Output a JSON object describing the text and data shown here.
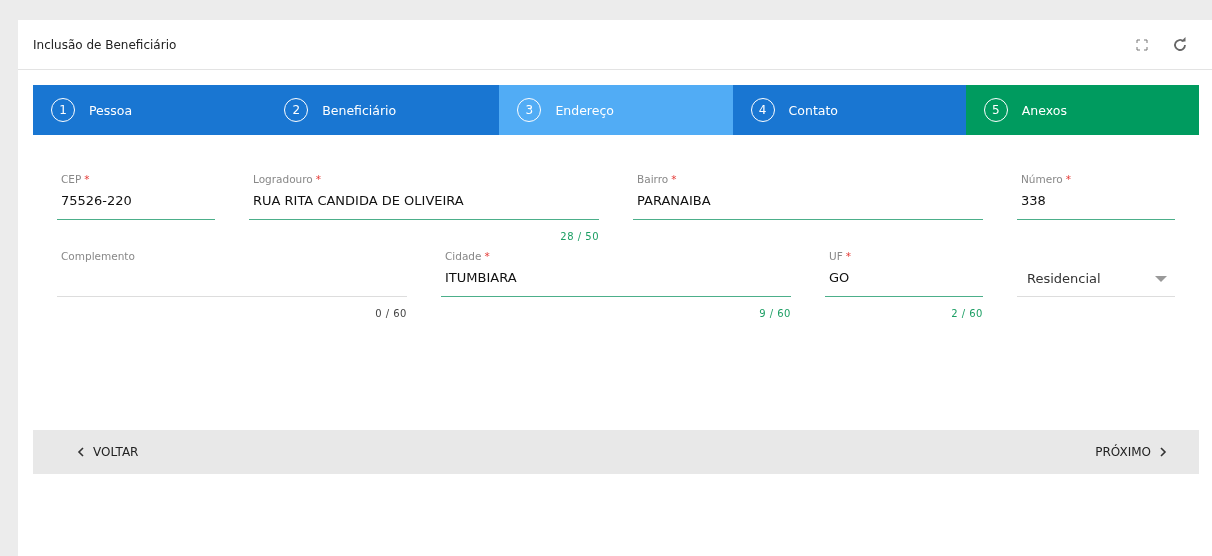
{
  "card": {
    "title": "Inclusão de Beneficiário"
  },
  "steps": [
    {
      "number": "1",
      "label": "Pessoa",
      "color": "#1976d2"
    },
    {
      "number": "2",
      "label": "Beneficiário",
      "color": "#1976d2"
    },
    {
      "number": "3",
      "label": "Endereço",
      "color": "#51acf5"
    },
    {
      "number": "4",
      "label": "Contato",
      "color": "#1976d2"
    },
    {
      "number": "5",
      "label": "Anexos",
      "color": "#009b5f"
    }
  ],
  "field_rows": [
    [
      {
        "kind": "text",
        "label": "CEP",
        "required_mark": "*",
        "value": "75526-220"
      },
      {
        "kind": "text",
        "label": "Logradouro",
        "required_mark": "*",
        "value": "RUA RITA CANDIDA DE OLIVEIRA",
        "counter": "28 / 50"
      },
      {
        "kind": "text",
        "label": "Bairro",
        "required_mark": "*",
        "value": "PARANAIBA"
      },
      {
        "kind": "text",
        "label": "Número",
        "required_mark": "*",
        "value": "338"
      }
    ],
    [
      {
        "kind": "text",
        "label": "Complemento",
        "counter": "0 / 60"
      },
      {
        "kind": "text",
        "label": "Cidade",
        "required_mark": "*",
        "value": "ITUMBIARA",
        "counter": "9 / 60"
      },
      {
        "kind": "text",
        "label": "UF",
        "required_mark": "*",
        "value": "GO",
        "counter": "2 / 60"
      },
      {
        "kind": "select",
        "value": "Residencial"
      }
    ]
  ],
  "footer": {
    "back": "VOLTAR",
    "next": "PRÓXIMO"
  }
}
